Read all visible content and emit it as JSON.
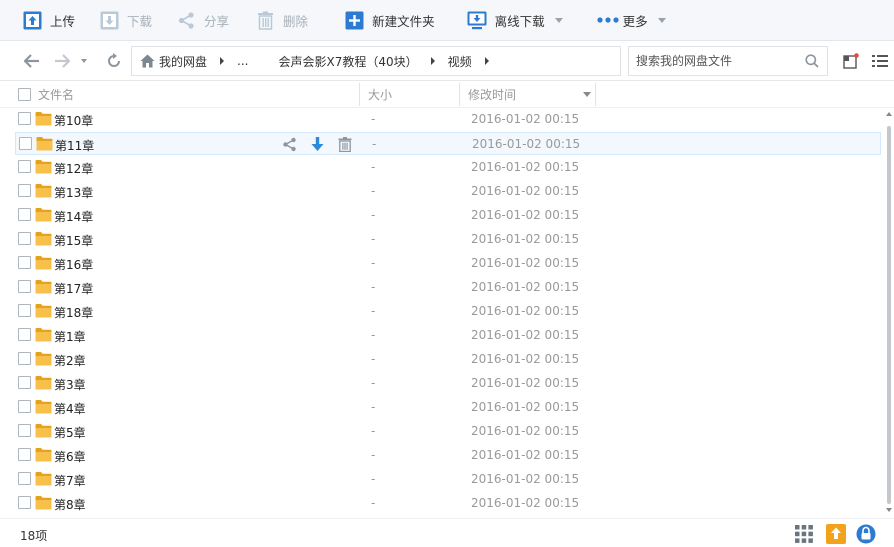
{
  "toolbar": {
    "upload": "上传",
    "download": "下载",
    "share": "分享",
    "delete": "删除",
    "new_folder": "新建文件夹",
    "offline_download": "离线下载",
    "more": "更多"
  },
  "breadcrumb": {
    "root": "我的网盘",
    "ellipsis": "...",
    "folder": "会声会影X7教程（40块）",
    "current": "视频"
  },
  "search": {
    "placeholder": "搜索我的网盘文件"
  },
  "columns": {
    "name": "文件名",
    "size": "大小",
    "modified": "修改时间"
  },
  "files": [
    {
      "name": "第10章",
      "size": "-",
      "modified": "2016-01-02 00:15"
    },
    {
      "name": "第11章",
      "size": "-",
      "modified": "2016-01-02 00:15"
    },
    {
      "name": "第12章",
      "size": "-",
      "modified": "2016-01-02 00:15"
    },
    {
      "name": "第13章",
      "size": "-",
      "modified": "2016-01-02 00:15"
    },
    {
      "name": "第14章",
      "size": "-",
      "modified": "2016-01-02 00:15"
    },
    {
      "name": "第15章",
      "size": "-",
      "modified": "2016-01-02 00:15"
    },
    {
      "name": "第16章",
      "size": "-",
      "modified": "2016-01-02 00:15"
    },
    {
      "name": "第17章",
      "size": "-",
      "modified": "2016-01-02 00:15"
    },
    {
      "name": "第18章",
      "size": "-",
      "modified": "2016-01-02 00:15"
    },
    {
      "name": "第1章",
      "size": "-",
      "modified": "2016-01-02 00:15"
    },
    {
      "name": "第2章",
      "size": "-",
      "modified": "2016-01-02 00:15"
    },
    {
      "name": "第3章",
      "size": "-",
      "modified": "2016-01-02 00:15"
    },
    {
      "name": "第4章",
      "size": "-",
      "modified": "2016-01-02 00:15"
    },
    {
      "name": "第5章",
      "size": "-",
      "modified": "2016-01-02 00:15"
    },
    {
      "name": "第6章",
      "size": "-",
      "modified": "2016-01-02 00:15"
    },
    {
      "name": "第7章",
      "size": "-",
      "modified": "2016-01-02 00:15"
    },
    {
      "name": "第8章",
      "size": "-",
      "modified": "2016-01-02 00:15"
    }
  ],
  "hovered_row": 1,
  "status": {
    "count": "18项"
  },
  "colors": {
    "accent": "#2d7bd0",
    "folder": "#f7c04a",
    "folder_dark": "#e5a21e",
    "muted": "#a8b0b8"
  }
}
